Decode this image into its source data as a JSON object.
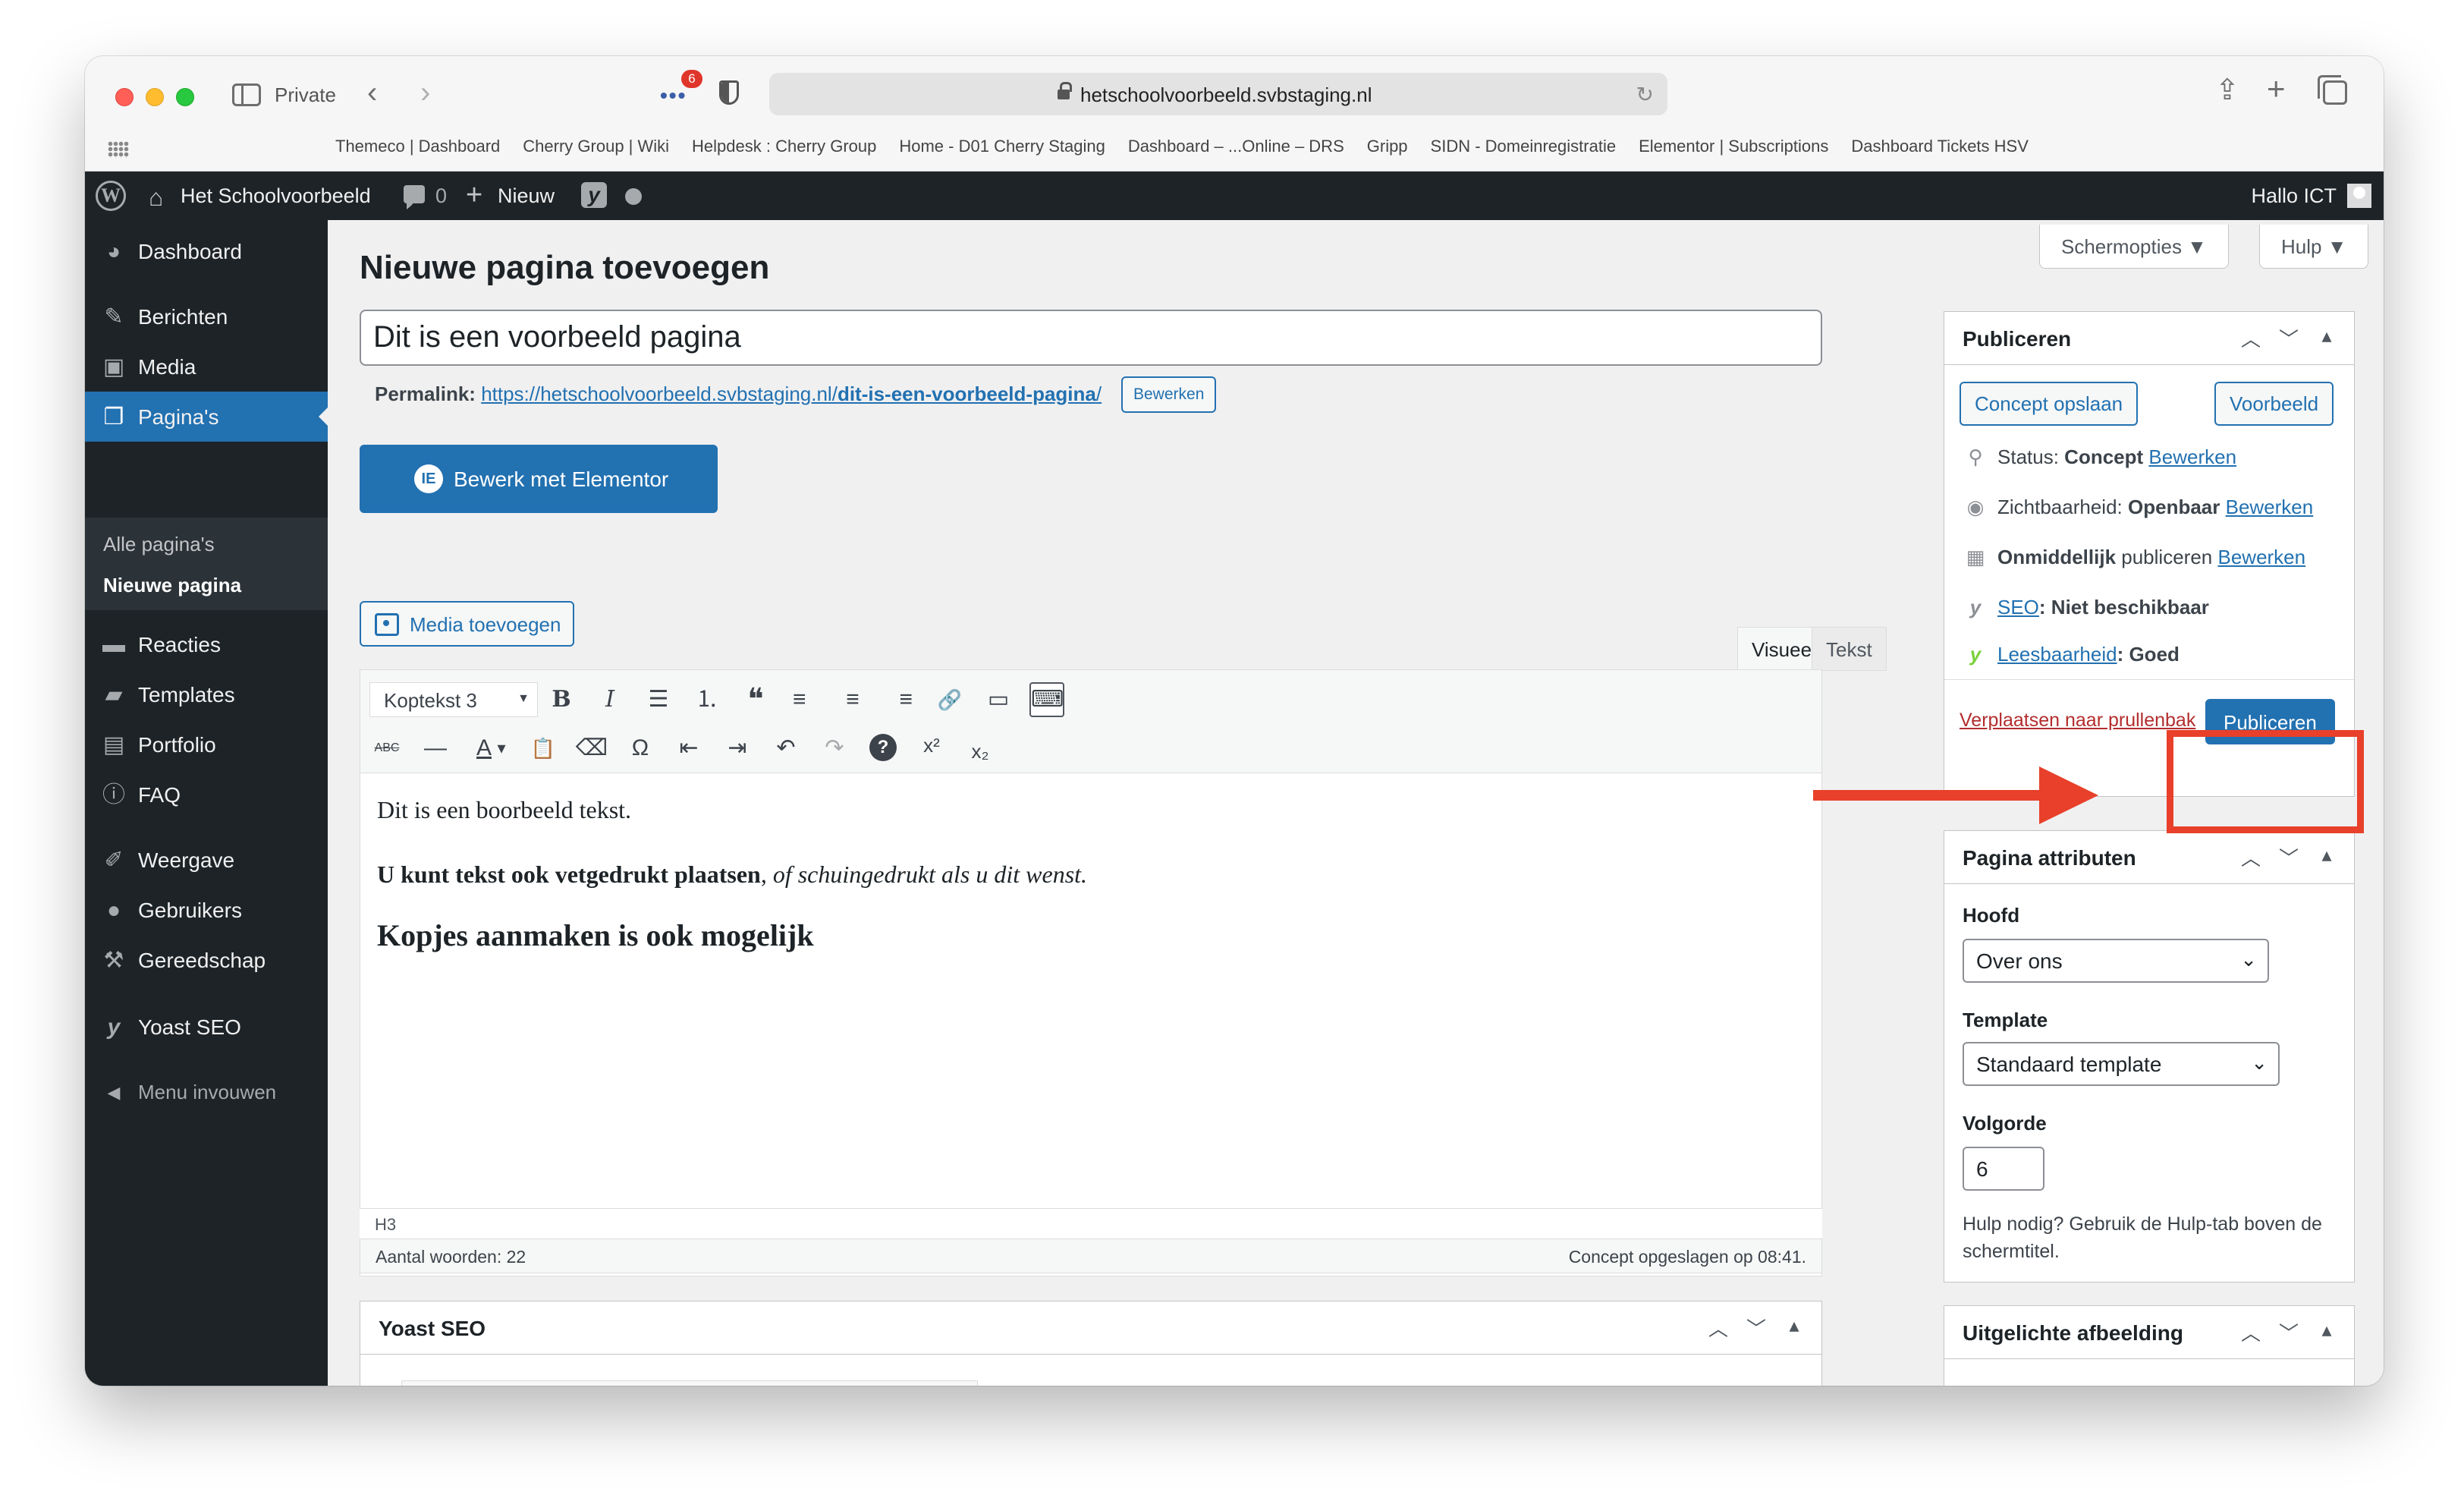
{
  "browser": {
    "private_label": "Private",
    "extension_badge": "6",
    "url": "hetschoolvoorbeeld.svbstaging.nl",
    "favorites": [
      "Themeco | Dashboard",
      "Cherry Group | Wiki",
      "Helpdesk : Cherry Group",
      "Home - D01 Cherry Staging",
      "Dashboard – ...Online – DRS",
      "Gripp",
      "SIDN - Domeinregistratie",
      "Elementor | Subscriptions",
      "Dashboard Tickets HSV"
    ]
  },
  "adminbar": {
    "site_name": "Het Schoolvoorbeeld",
    "comments_count": "0",
    "new_label": "Nieuw",
    "yoast_glyph": "y",
    "howdy": "Hallo ICT"
  },
  "sidebar": {
    "items": [
      {
        "label": "Dashboard",
        "icon": "dashboard-icon",
        "glyph": "◕"
      },
      {
        "label": "Berichten",
        "icon": "pushpin-icon",
        "glyph": "✎"
      },
      {
        "label": "Media",
        "icon": "media-icon",
        "glyph": "▣"
      },
      {
        "label": "Pagina's",
        "icon": "pages-icon",
        "glyph": "❐"
      },
      {
        "label": "Reacties",
        "icon": "comments-icon",
        "glyph": "▬"
      },
      {
        "label": "Templates",
        "icon": "folder-icon",
        "glyph": "▰"
      },
      {
        "label": "Portfolio",
        "icon": "portfolio-icon",
        "glyph": "▤"
      },
      {
        "label": "FAQ",
        "icon": "info-icon",
        "glyph": "ⓘ"
      },
      {
        "label": "Weergave",
        "icon": "brush-icon",
        "glyph": "✐"
      },
      {
        "label": "Gebruikers",
        "icon": "users-icon",
        "glyph": "●"
      },
      {
        "label": "Gereedschap",
        "icon": "wrench-icon",
        "glyph": "⚒"
      },
      {
        "label": "Yoast SEO",
        "icon": "yoast-icon",
        "glyph": "y"
      }
    ],
    "submenu": [
      "Alle pagina's",
      "Nieuwe pagina"
    ],
    "collapse_label": "Menu invouwen",
    "collapse_glyph": "◀"
  },
  "screen_options": {
    "label": "Schermopties ▼",
    "help": "Hulp ▼"
  },
  "page": {
    "title": "Nieuwe pagina toevoegen",
    "post_title": "Dit is een voorbeeld pagina",
    "permalink_label": "Permalink:",
    "permalink_base": "https://hetschoolvoorbeeld.svbstaging.nl/",
    "permalink_slug": "dit-is-een-voorbeeld-pagina",
    "permalink_tail": "/",
    "permalink_edit": "Bewerken",
    "elementor_logo": "IE",
    "elementor_button": "Bewerk met Elementor",
    "media_button": "Media toevoegen"
  },
  "editor": {
    "tab_visual": "Visueel",
    "tab_text": "Tekst",
    "format_select": "Koptekst 3",
    "toolbar_row1": [
      {
        "name": "bold-icon",
        "glyph": "B"
      },
      {
        "name": "italic-icon",
        "glyph": "I"
      },
      {
        "name": "bullet-list-icon",
        "glyph": "☰"
      },
      {
        "name": "numbered-list-icon",
        "glyph": "⒈"
      },
      {
        "name": "blockquote-icon",
        "glyph": "❝"
      },
      {
        "name": "align-left-icon",
        "glyph": "≡"
      },
      {
        "name": "align-center-icon",
        "glyph": "≡"
      },
      {
        "name": "align-right-icon",
        "glyph": "≡"
      },
      {
        "name": "link-icon",
        "glyph": "🔗"
      },
      {
        "name": "read-more-icon",
        "glyph": "▭"
      },
      {
        "name": "toolbar-toggle-icon",
        "glyph": "⌨"
      }
    ],
    "toolbar_row2": [
      {
        "name": "strikethrough-icon",
        "glyph": "ABC"
      },
      {
        "name": "horizontal-line-icon",
        "glyph": "—"
      },
      {
        "name": "text-color-icon",
        "glyph": "A"
      },
      {
        "name": "text-color-dropdown-icon",
        "glyph": "▾"
      },
      {
        "name": "paste-text-icon",
        "glyph": "📋"
      },
      {
        "name": "clear-formatting-icon",
        "glyph": "⌫"
      },
      {
        "name": "special-character-icon",
        "glyph": "Ω"
      },
      {
        "name": "outdent-icon",
        "glyph": "⇤"
      },
      {
        "name": "indent-icon",
        "glyph": "⇥"
      },
      {
        "name": "undo-icon",
        "glyph": "↶"
      },
      {
        "name": "redo-icon",
        "glyph": "↷"
      },
      {
        "name": "help-icon",
        "glyph": "?"
      },
      {
        "name": "superscript-icon",
        "glyph": "x²"
      },
      {
        "name": "subscript-icon",
        "glyph": "x₂"
      }
    ],
    "paragraph1": "Dit is een boorbeeld tekst.",
    "p2_bold": "U kunt tekst ook vetgedrukt plaatsen",
    "p2_sep": ", ",
    "p2_italic": "of schuingedrukt als u dit wenst.",
    "heading": "Kopjes aanmaken is ook mogelijk",
    "path": "H3",
    "word_count": "Aantal woorden: 22",
    "saved_status": "Concept opgeslagen op 08:41."
  },
  "yoast_box": {
    "title": "Yoast SEO"
  },
  "publish_box": {
    "title": "Publiceren",
    "save_draft": "Concept opslaan",
    "preview": "Voorbeeld",
    "status_label": "Status:",
    "status_value": "Concept",
    "visibility_label": "Zichtbaarheid:",
    "visibility_value": "Openbaar",
    "schedule_label": "Onmiddellijk",
    "schedule_tail": "publiceren",
    "edit_link": "Bewerken",
    "seo_link": "SEO",
    "seo_value": ": Niet beschikbaar",
    "readability_link": "Leesbaarheid",
    "readability_value": ": Goed",
    "trash_link": "Verplaatsen naar prullenbak",
    "publish_button": "Publiceren"
  },
  "attributes_box": {
    "title": "Pagina attributen",
    "parent_label": "Hoofd",
    "parent_value": "Over ons",
    "template_label": "Template",
    "template_value": "Standaard template",
    "order_label": "Volgorde",
    "order_value": "6",
    "help_text": "Hulp nodig? Gebruik de Hulp-tab boven de schermtitel."
  },
  "featured_box": {
    "title": "Uitgelichte afbeelding"
  },
  "colors": {
    "accent": "#2271b1",
    "adminbar": "#1d2327",
    "annotation": "#e8402a"
  }
}
